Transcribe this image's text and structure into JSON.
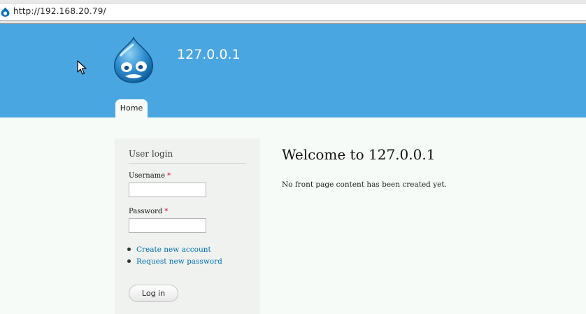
{
  "browser": {
    "url": "http://192.168.20.79/",
    "favicon": "drupal-drop-icon"
  },
  "site": {
    "name": "127.0.0.1",
    "logo": "drupal-logo-icon",
    "header_color": "#4aa6e0"
  },
  "nav": {
    "tabs": [
      {
        "label": "Home",
        "active": true
      }
    ]
  },
  "login_block": {
    "title": "User login",
    "username_label": "Username",
    "password_label": "Password",
    "required_marker": "*",
    "username_value": "",
    "password_value": "",
    "links": [
      {
        "label": "Create new account"
      },
      {
        "label": "Request new password"
      }
    ],
    "submit_label": "Log in"
  },
  "main": {
    "title": "Welcome to 127.0.0.1",
    "message": "No front page content has been created yet."
  },
  "colors": {
    "link": "#0071b3",
    "required": "#e2001a",
    "page_background": "#f6fbf7"
  }
}
